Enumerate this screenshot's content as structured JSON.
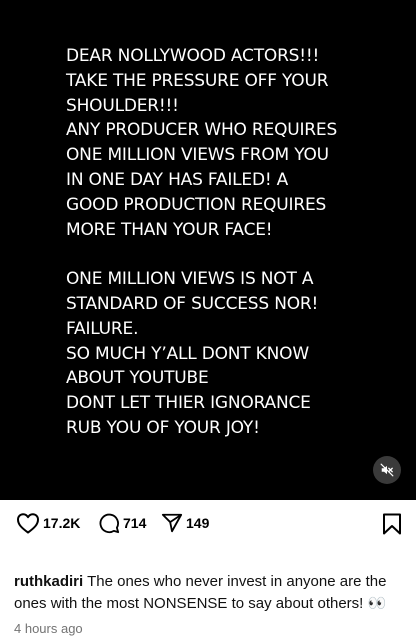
{
  "post": {
    "lines": [
      "DEAR NOLLYWOOD ACTORS!!!",
      "TAKE THE PRESSURE OFF YOUR",
      "SHOULDER!!!",
      "ANY PRODUCER WHO REQUIRES",
      "ONE MILLION VIEWS FROM YOU",
      "IN ONE DAY HAS FAILED! A",
      "GOOD PRODUCTION REQUIRES",
      "MORE THAN YOUR FACE!",
      "",
      "ONE MILLION VIEWS IS NOT A",
      "STANDARD OF SUCCESS NOR!",
      "FAILURE.",
      "SO MUCH Y’ALL DONT KNOW",
      "ABOUT YOUTUBE",
      "DONT LET THIER IGNORANCE",
      "RUB YOU OF YOUR JOY!"
    ],
    "mute_icon": "muted-speaker-icon"
  },
  "actions": {
    "likes": "17.2K",
    "comments": "714",
    "shares": "149",
    "icons": [
      "heart-icon",
      "comment-icon",
      "send-icon",
      "bookmark-icon"
    ]
  },
  "caption": {
    "username": "ruthkadiri",
    "text": " The ones who never  invest in anyone are the ones with the most NONSENSE to say about others! 👀",
    "time": "4 hours ago"
  },
  "colors": {
    "media_bg": "#000000",
    "text": "#ffffff",
    "muted_time": "#737373"
  }
}
